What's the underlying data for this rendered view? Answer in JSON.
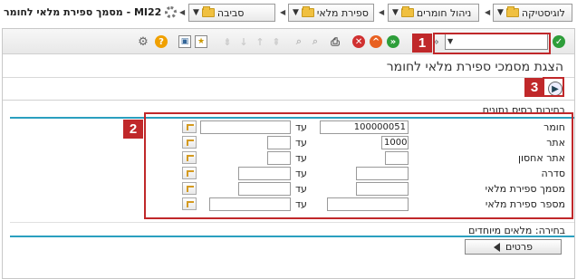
{
  "breadcrumbs": [
    {
      "label": "לוגיסטיקה"
    },
    {
      "label": "ניהול חומרים"
    },
    {
      "label": "ספירת מלאי"
    },
    {
      "label": "סביבה"
    }
  ],
  "transaction": {
    "code": "MI22",
    "title": "מסמך ספירת מלאי לחומר",
    "full": "MI22 - מסמך ספירת מלאי לחומר"
  },
  "page_title": "הצגת מסמכי ספירת מלאי לחומר",
  "callouts": {
    "one": "1",
    "two": "2",
    "three": "3"
  },
  "group_database": {
    "title": "בחירות בסיס נתונים",
    "to_label": "עד",
    "rows": [
      {
        "label": "חומר",
        "from": "100000051",
        "to": ""
      },
      {
        "label": "אתר",
        "from": "1000",
        "to": ""
      },
      {
        "label": "אתר אחסון",
        "from": "",
        "to": ""
      },
      {
        "label": "סדרה",
        "from": "",
        "to": ""
      },
      {
        "label": "מסמך ספירת מלאי",
        "from": "",
        "to": ""
      },
      {
        "label": "מספר ספירת מלאי",
        "from": "",
        "to": ""
      }
    ]
  },
  "group_special": {
    "title": "בחירה: מלאים מיוחדים"
  },
  "details_button": "פרטים",
  "colors": {
    "accent_line": "#2a9fbf",
    "callout": "#c0282a",
    "ok_green": "#2e9e3a",
    "cancel_red": "#d03030",
    "help_orange": "#f0a000"
  }
}
